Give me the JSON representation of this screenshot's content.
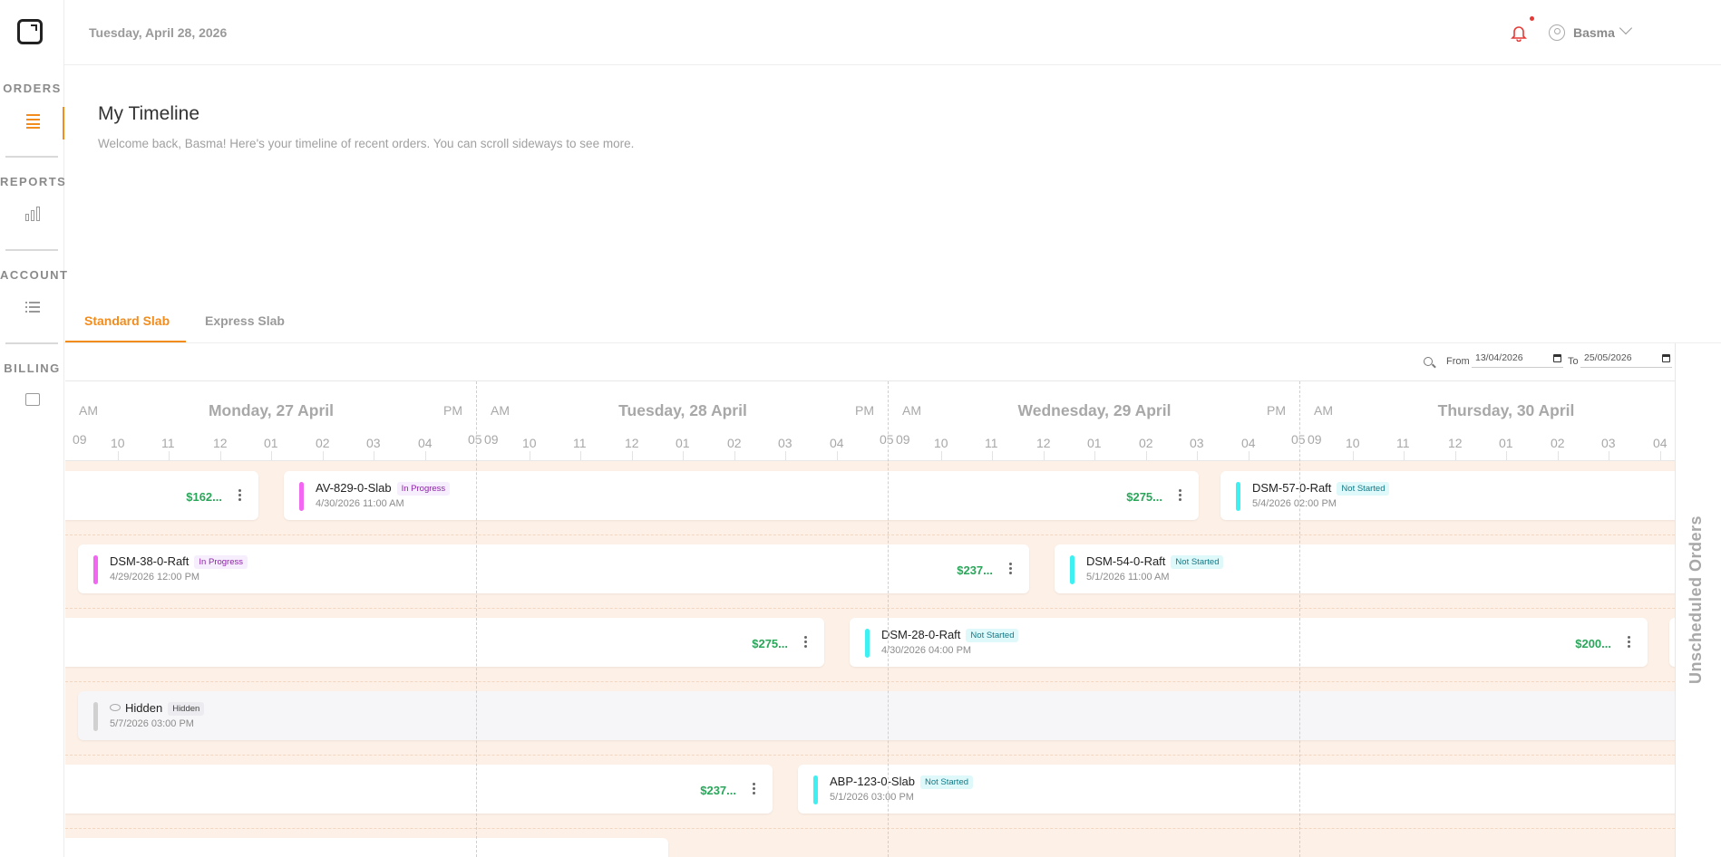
{
  "header": {
    "date": "Tuesday, April 28, 2026",
    "user_name": "Basma"
  },
  "sidebar": {
    "sections": [
      {
        "label": "ORDERS",
        "icon": "orders-list-icon",
        "active": true
      },
      {
        "label": "REPORTS",
        "icon": "bar-chart-icon",
        "active": false
      },
      {
        "label": "ACCOUNT",
        "icon": "list-icon",
        "active": false
      },
      {
        "label": "BILLING",
        "icon": "billing-box-icon",
        "active": false
      }
    ]
  },
  "page": {
    "title": "My Timeline",
    "subtitle": "Welcome back, Basma! Here's your timeline of recent orders. You can scroll sideways to see more."
  },
  "tabs": [
    {
      "label": "Standard Slab",
      "active": true
    },
    {
      "label": "Express Slab",
      "active": false
    }
  ],
  "filters": {
    "from_label": "From",
    "from_value": "13/04/2026",
    "to_label": "To",
    "to_value": "25/05/2026"
  },
  "timeline": {
    "days": [
      {
        "name": "Monday, 27 April",
        "am": "AM",
        "pm": "PM"
      },
      {
        "name": "Tuesday, 28 April",
        "am": "AM",
        "pm": "PM"
      },
      {
        "name": "Wednesday, 29 April",
        "am": "AM",
        "pm": "PM"
      },
      {
        "name": "Thursday, 30 April",
        "am": "AM",
        "pm": ""
      }
    ],
    "hours": [
      "09",
      "10",
      "11",
      "12",
      "01",
      "02",
      "03",
      "04",
      "05"
    ],
    "last_day_hours": [
      "09",
      "10",
      "11",
      "12",
      "01",
      "02",
      "03",
      "04"
    ]
  },
  "orders": [
    {
      "title": "",
      "status": "",
      "date": "",
      "price": "$162...",
      "accent": ""
    },
    {
      "title": "AV-829-0-Slab",
      "status": "In Progress",
      "date": "4/30/2026 11:00 AM",
      "price": "$275...",
      "accent": "#f266f2"
    },
    {
      "title": "DSM-57-0-Raft",
      "status": "Not Started",
      "date": "5/4/2026 02:00 PM",
      "price": "",
      "accent": "#3ff0f2"
    },
    {
      "title": "DSM-38-0-Raft",
      "status": "In Progress",
      "date": "4/29/2026 12:00 PM",
      "price": "$237...",
      "accent": "#f266f2"
    },
    {
      "title": "DSM-54-0-Raft",
      "status": "Not Started",
      "date": "5/1/2026 11:00 AM",
      "price": "",
      "accent": "#3ff0f2"
    },
    {
      "title": "",
      "status": "",
      "date": "",
      "price": "$275...",
      "accent": ""
    },
    {
      "title": "DSM-28-0-Raft",
      "status": "Not Started",
      "date": "4/30/2026 04:00 PM",
      "price": "$200...",
      "accent": "#3ff0f2"
    },
    {
      "title": "Hidden",
      "status": "Hidden",
      "date": "5/7/2026 03:00 PM",
      "price": "",
      "accent": "#d0d0d0"
    },
    {
      "title": "",
      "status": "",
      "date": "",
      "price": "$237...",
      "accent": ""
    },
    {
      "title": "ABP-123-0-Slab",
      "status": "Not Started",
      "date": "5/1/2026 03:00 PM",
      "price": "",
      "accent": "#3ff0f2"
    }
  ],
  "unscheduled_label": "Unscheduled Orders",
  "colors": {
    "accent": "#f28c1d",
    "price": "#2aa65a",
    "in_progress": "#f266f2",
    "not_started": "#3ff0f2"
  }
}
